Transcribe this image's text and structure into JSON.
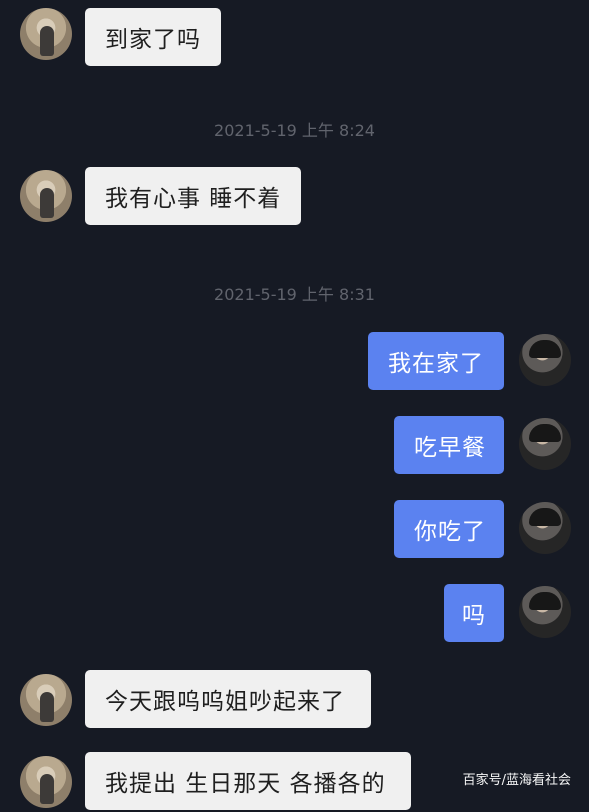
{
  "messages": [
    {
      "text": "到家了吗"
    },
    {
      "text": "我有心事 睡不着"
    },
    {
      "text": "我在家了"
    },
    {
      "text": "吃早餐"
    },
    {
      "text": "你吃了"
    },
    {
      "text": "吗"
    },
    {
      "text": "今天跟呜呜姐吵起来了"
    },
    {
      "text": "我提出 生日那天 各播各的"
    }
  ],
  "timestamps": [
    "2021-5-19 上午 8:24",
    "2021-5-19 上午 8:31"
  ],
  "watermark": "百家号/蓝海看社会",
  "colors": {
    "background": "#161a24",
    "incoming_bubble": "#f0f0f0",
    "outgoing_bubble": "#5b82f0",
    "timestamp": "#61646d"
  }
}
